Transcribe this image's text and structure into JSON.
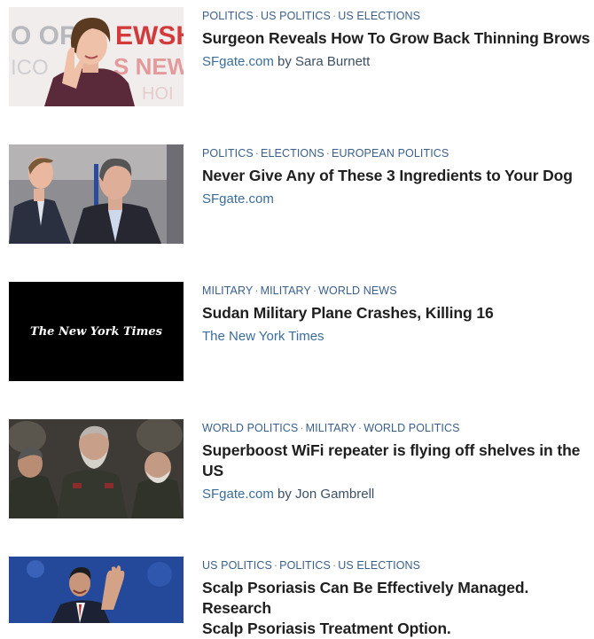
{
  "articles": [
    {
      "categories": [
        "POLITICS",
        "US POLITICS",
        "US ELECTIONS"
      ],
      "title": "Surgeon Reveals How To Grow Back Thinning Brows",
      "publisher": "SFgate.com",
      "byline": "by Sara Burnett",
      "thumb_text": "O OR   EWSH   ICO   S NEW"
    },
    {
      "categories": [
        "POLITICS",
        "ELECTIONS",
        "EUROPEAN POLITICS"
      ],
      "title": "Never Give Any of These 3 Ingredients to Your Dog",
      "publisher": "SFgate.com",
      "byline": ""
    },
    {
      "categories": [
        "MILITARY",
        "MILITARY",
        "WORLD NEWS"
      ],
      "title": "Sudan Military Plane Crashes, Killing 16",
      "publisher": "The New York Times",
      "byline": "",
      "thumb_text": "The New York Times"
    },
    {
      "categories": [
        "WORLD POLITICS",
        "MILITARY",
        "WORLD POLITICS"
      ],
      "title": "Superboost WiFi repeater is flying off shelves in the US",
      "publisher": "SFgate.com",
      "byline": "by Jon Gambrell"
    },
    {
      "categories": [
        "US POLITICS",
        "POLITICS",
        "US ELECTIONS"
      ],
      "title_line1": "Scalp Psoriasis Can Be Effectively Managed. Research",
      "title_line2": "Scalp Psoriasis Treatment Option.",
      "publisher": "",
      "byline": ""
    }
  ],
  "separator": "·",
  "colors": {
    "category": "#3a5f8c",
    "title": "#1f1f1f",
    "publisher": "#3a6c9c"
  }
}
